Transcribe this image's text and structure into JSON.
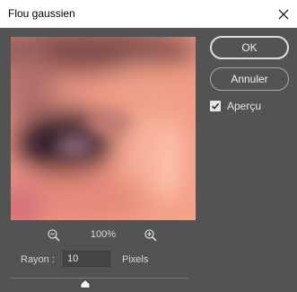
{
  "window": {
    "title": "Flou gaussien",
    "close_icon": "close-icon"
  },
  "buttons": {
    "ok_label": "OK",
    "cancel_label": "Annuler"
  },
  "preview_option": {
    "label": "Aperçu",
    "checked": true
  },
  "zoom": {
    "level": "100%",
    "zoom_out_icon": "zoom-out-icon",
    "zoom_in_icon": "zoom-in-icon"
  },
  "radius": {
    "label": "Rayon :",
    "value": "10",
    "unit": "Pixels"
  },
  "slider": {
    "value": 10
  },
  "colors": {
    "panel_bg": "#535353",
    "titlebar_bg": "#ffffff",
    "preview_skin": "#e8907c"
  }
}
